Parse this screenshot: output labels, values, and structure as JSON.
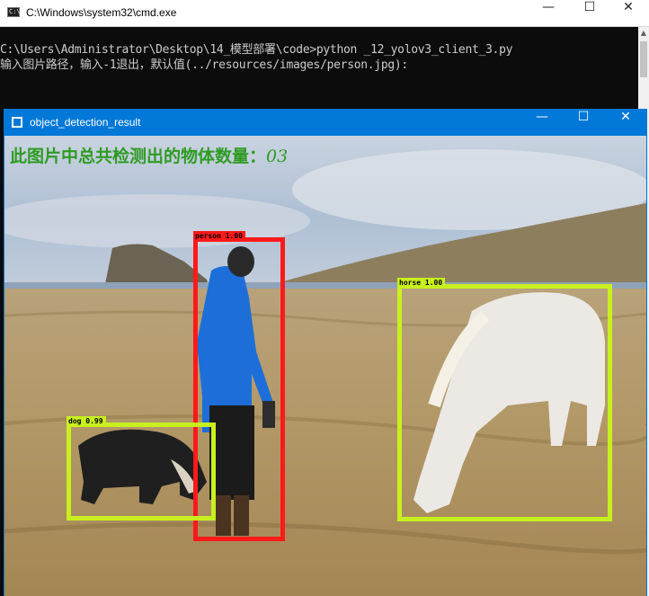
{
  "cmd": {
    "title": "C:\\Windows\\system32\\cmd.exe",
    "icon": "cmd-icon",
    "line1": "C:\\Users\\Administrator\\Desktop\\14_模型部署\\code>python _12_yolov3_client_3.py",
    "line2": "输入图片路径，输入-1退出，默认值(../resources/images/person.jpg):"
  },
  "result_window": {
    "title": "object_detection_result",
    "count_text": "此图片中总共检测出的物体数量：",
    "count_value": "03"
  },
  "detections": [
    {
      "label": "person 1.00",
      "color": "#ff1a1a"
    },
    {
      "label": "horse 1.00",
      "color": "#c8f01e"
    },
    {
      "label": "dog 0.99",
      "color": "#c8f01e"
    }
  ],
  "controls": {
    "minimize": "—",
    "maximize": "☐",
    "close": "✕"
  }
}
